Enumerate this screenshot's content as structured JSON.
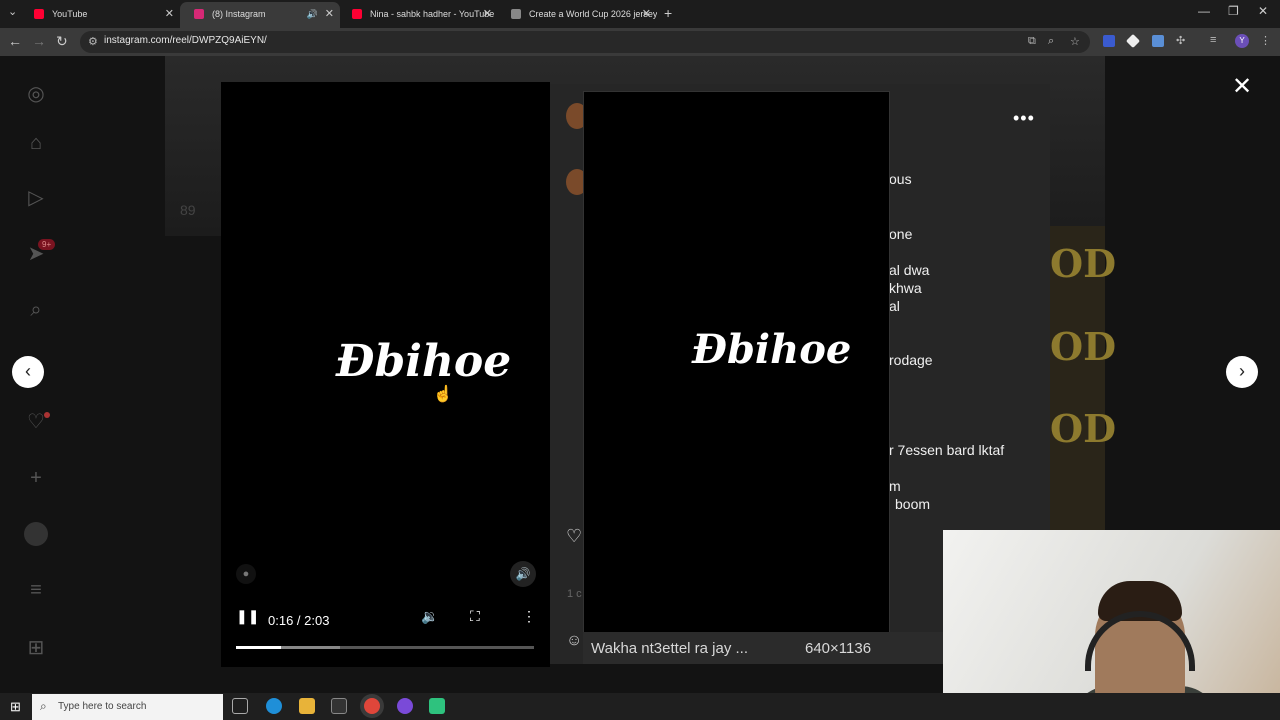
{
  "browser": {
    "tabs": [
      {
        "title": "YouTube",
        "favicon_color": "#ff0033"
      },
      {
        "title": "(8) Instagram",
        "favicon_color": "#d62976",
        "active": true
      },
      {
        "title": "Nina - sahbk hadher - YouTube",
        "favicon_color": "#ff0033"
      },
      {
        "title": "Create a World Cup 2026 jersey",
        "favicon_color": "#888888"
      }
    ],
    "url": "instagram.com/reel/DWPZQ9AiEYN/",
    "profile_initial": "Y"
  },
  "sidebar": {
    "notifications_badge": "9+"
  },
  "background": {
    "views_text": "89",
    "gold_text": "OD"
  },
  "post": {
    "caption_fragments": [
      "ous",
      "one",
      "al dwa",
      "khwa",
      "al",
      "rodage",
      "r 7essen bard lktaf",
      "m",
      "boom"
    ],
    "likes_meta": "1 c"
  },
  "video": {
    "logo_text": "Ɖbihoe",
    "time": "0:16 / 2:03",
    "progress_played": 0.15,
    "progress_buffered": 0.35
  },
  "popup": {
    "logo_text": "Ɖbihoe",
    "title": "Wakha nt3ettel ra jay ...",
    "dimensions": "640×1136"
  },
  "taskbar": {
    "search_placeholder": "Type here to search"
  }
}
